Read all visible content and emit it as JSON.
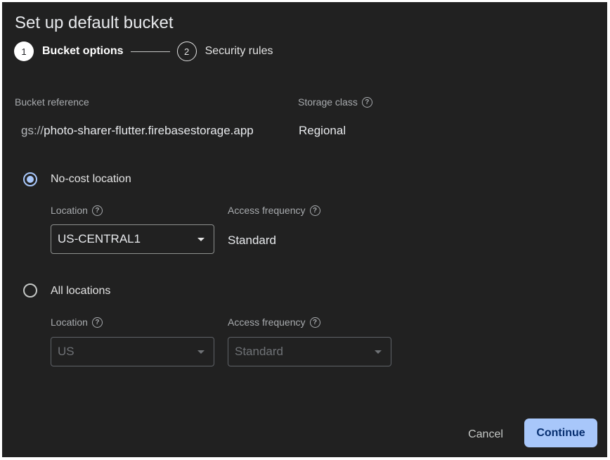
{
  "dialog": {
    "title": "Set up default bucket"
  },
  "stepper": {
    "steps": [
      {
        "number": "1",
        "label": "Bucket options",
        "active": true
      },
      {
        "number": "2",
        "label": "Security rules",
        "active": false
      }
    ]
  },
  "bucket": {
    "reference_label": "Bucket reference",
    "reference_prefix": "gs://",
    "reference_value": "photo-sharer-flutter.firebasestorage.app",
    "storage_class_label": "Storage class",
    "storage_class_value": "Regional"
  },
  "options": {
    "no_cost": {
      "label": "No-cost location",
      "selected": true,
      "location_label": "Location",
      "location_value": "US-CENTRAL1",
      "access_label": "Access frequency",
      "access_value": "Standard"
    },
    "all": {
      "label": "All locations",
      "selected": false,
      "location_label": "Location",
      "location_value": "US",
      "access_label": "Access frequency",
      "access_value": "Standard"
    }
  },
  "actions": {
    "cancel_label": "Cancel",
    "continue_label": "Continue"
  },
  "colors": {
    "background": "#212121",
    "accent": "#a8c7fa",
    "accent_text": "#062e6f"
  },
  "icons": {
    "help": "help-circle-icon",
    "dropdown": "caret-down-icon"
  }
}
